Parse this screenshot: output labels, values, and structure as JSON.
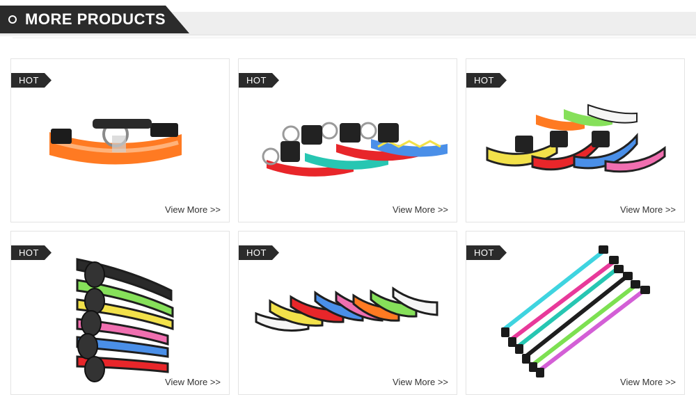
{
  "header": {
    "title": "MORE PRODUCTS"
  },
  "badge_label": "HOT",
  "view_more_label": "View More >>",
  "colors": {
    "dark": "#2b2b2b",
    "band": "#eeeeee",
    "orange": "#ff7a22",
    "green": "#86e05a",
    "yellow": "#f2e14a",
    "red": "#e8262a",
    "blue": "#4a8fe8",
    "pink": "#f06fb0",
    "cyan": "#3fd4e0",
    "magenta": "#e8399a",
    "teal": "#27c6b2",
    "lime": "#7de052",
    "violet": "#d35fd6"
  },
  "products": [
    {
      "badge": "HOT",
      "image": "orange-led-dog-collar",
      "link": "View More >>"
    },
    {
      "badge": "HOT",
      "image": "patterned-dog-collars",
      "link": "View More >>"
    },
    {
      "badge": "HOT",
      "image": "colored-led-collars-group",
      "link": "View More >>"
    },
    {
      "badge": "HOT",
      "image": "stacked-led-collars",
      "link": "View More >>"
    },
    {
      "badge": "HOT",
      "image": "row-of-led-collars",
      "link": "View More >>"
    },
    {
      "badge": "HOT",
      "image": "slim-colored-collars",
      "link": "View More >>"
    }
  ]
}
